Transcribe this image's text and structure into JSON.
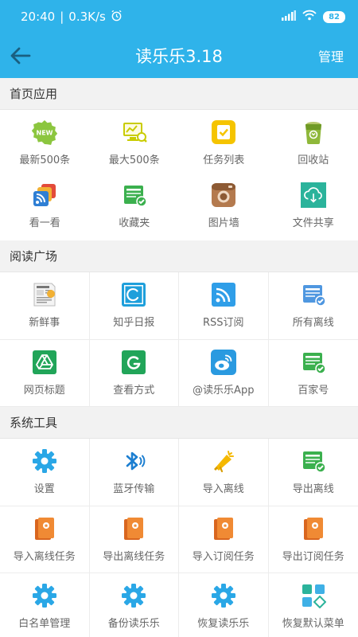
{
  "status": {
    "time": "20:40",
    "speed": "0.3K/s",
    "battery": "82"
  },
  "appbar": {
    "title": "读乐乐3.18",
    "manage": "管理"
  },
  "sections": {
    "home": {
      "title": "首页应用",
      "items": [
        "最新500条",
        "最大500条",
        "任务列表",
        "回收站",
        "看一看",
        "收藏夹",
        "图片墙",
        "文件共享"
      ]
    },
    "reading": {
      "title": "阅读广场",
      "items": [
        "新鲜事",
        "知乎日报",
        "RSS订阅",
        "所有离线",
        "网页标题",
        "查看方式",
        "@读乐乐App",
        "百家号"
      ]
    },
    "tools": {
      "title": "系统工具",
      "items": [
        "设置",
        "蓝牙传输",
        "导入离线",
        "导出离线",
        "导入离线任务",
        "导出离线任务",
        "导入订阅任务",
        "导出订阅任务",
        "白名单管理",
        "备份读乐乐",
        "恢复读乐乐",
        "恢复默认菜单"
      ]
    }
  },
  "badge": {
    "new": "NEW"
  },
  "colors": {
    "primary": "#2fb3ea"
  }
}
